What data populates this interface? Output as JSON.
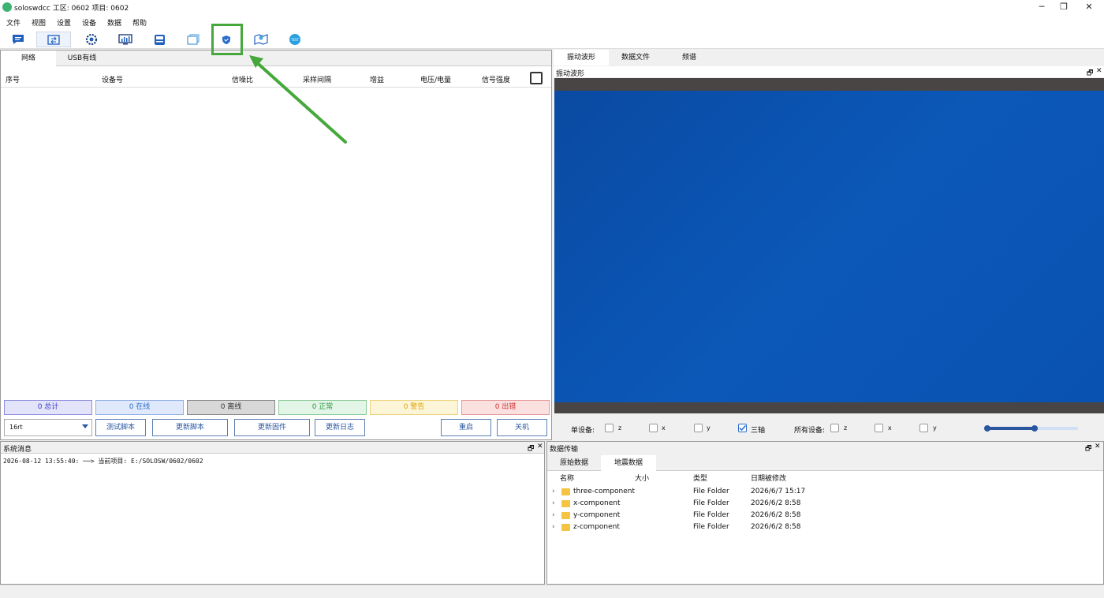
{
  "titlebar": {
    "title": "soloswdcc 工区: 0602  项目: 0602",
    "minimize": "─",
    "restore": "❐",
    "close": "✕"
  },
  "menu": [
    "文件",
    "视图",
    "设置",
    "设备",
    "数据",
    "帮助"
  ],
  "left": {
    "tabs": [
      "网络",
      "USB有线"
    ],
    "columns": [
      "序号",
      "设备号",
      "信噪比",
      "采样间隔",
      "增益",
      "电压/电量",
      "信号强度"
    ],
    "stats": [
      {
        "label": "0 总计",
        "color": "#3b3bc7",
        "bg": "#e3e3fa",
        "border": "#8e8ee0"
      },
      {
        "label": "0 在线",
        "color": "#2a6bd0",
        "bg": "#dfe9fb",
        "border": "#8fb0e6"
      },
      {
        "label": "0 离线",
        "color": "#333333",
        "bg": "#d8d8d8",
        "border": "#888888"
      },
      {
        "label": "0 正常",
        "color": "#2e9a46",
        "bg": "#e2f5e6",
        "border": "#8acc98"
      },
      {
        "label": "0 警告",
        "color": "#e0a300",
        "bg": "#fdf5d8",
        "border": "#ecd27a"
      },
      {
        "label": "0 出错",
        "color": "#d03434",
        "bg": "#fbe0e0",
        "border": "#e69898"
      }
    ],
    "script_value": "16rt",
    "buttons": [
      "测试脚本",
      "更新脚本",
      "更新固件",
      "更新日志",
      "重启",
      "关机"
    ]
  },
  "right": {
    "tabs": [
      "振动波形",
      "数据文件",
      "频谱"
    ],
    "wave_title": "振动波形",
    "single_label": "单设备:",
    "all_label": "所有设备:",
    "single_axes": [
      {
        "label": "z",
        "checked": false
      },
      {
        "label": "x",
        "checked": false
      },
      {
        "label": "y",
        "checked": false
      },
      {
        "label": "三轴",
        "checked": true
      }
    ],
    "all_axes": [
      {
        "label": "z",
        "checked": false
      },
      {
        "label": "x",
        "checked": false
      },
      {
        "label": "y",
        "checked": false
      }
    ],
    "slider": {
      "low": 0.0,
      "high": 0.52
    }
  },
  "sys": {
    "title": "系统消息",
    "log": "2026-08-12 13:55:40: ──> 当前项目: E:/SOLOSW/0602/0602"
  },
  "data": {
    "title": "数据传输",
    "tabs": [
      "原始数据",
      "地震数据"
    ],
    "headers": [
      "名称",
      "大小",
      "类型",
      "日期被修改"
    ],
    "files": [
      {
        "name": "three-component",
        "type": "File Folder",
        "date": "2026/6/7 15:17"
      },
      {
        "name": "x-component",
        "type": "File Folder",
        "date": "2026/6/2 8:58"
      },
      {
        "name": "y-component",
        "type": "File Folder",
        "date": "2026/6/2 8:58"
      },
      {
        "name": "z-component",
        "type": "File Folder",
        "date": "2026/6/2 8:58"
      }
    ]
  },
  "panel_controls": {
    "float": "🗗",
    "close": "✕"
  },
  "colors": {
    "accent": "#2a56a0",
    "highlight": "#46a83c",
    "wave_bg": "#0b58b8"
  }
}
